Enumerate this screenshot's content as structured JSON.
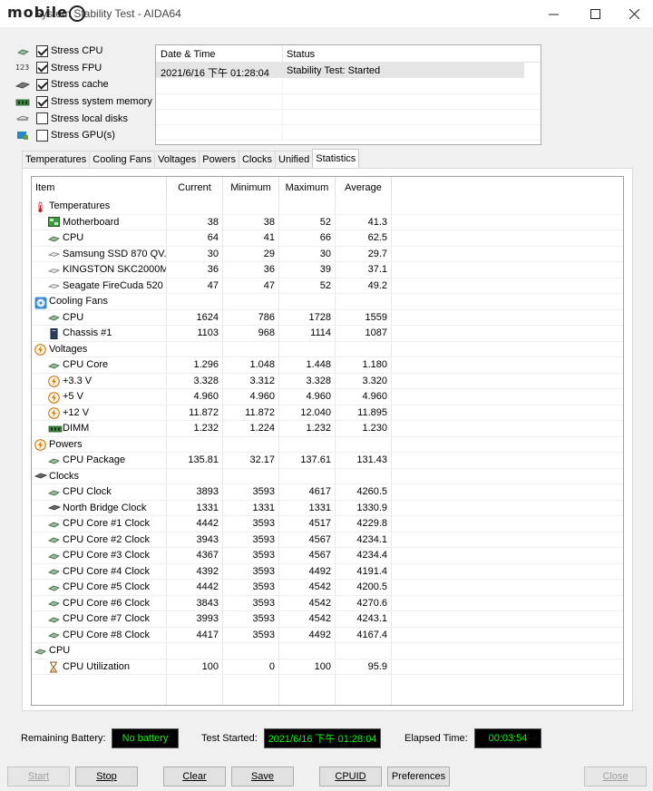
{
  "window": {
    "title": "System Stability Test - AIDA64",
    "watermark": "mobile01"
  },
  "stress_options": [
    {
      "label": "Stress CPU",
      "checked": true,
      "icon": "cpu-chip-icon"
    },
    {
      "label": "Stress FPU",
      "checked": true,
      "icon": "fpu-123-icon"
    },
    {
      "label": "Stress cache",
      "checked": true,
      "icon": "cache-chip-icon"
    },
    {
      "label": "Stress system memory",
      "checked": true,
      "icon": "memory-module-icon"
    },
    {
      "label": "Stress local disks",
      "checked": false,
      "icon": "disk-icon"
    },
    {
      "label": "Stress GPU(s)",
      "checked": false,
      "icon": "gpu-icon"
    }
  ],
  "log": {
    "headers": {
      "datetime": "Date & Time",
      "status": "Status"
    },
    "rows": [
      {
        "datetime": "2021/6/16 下午 01:28:04",
        "status": "Stability Test: Started"
      }
    ]
  },
  "tabs": [
    "Temperatures",
    "Cooling Fans",
    "Voltages",
    "Powers",
    "Clocks",
    "Unified",
    "Statistics"
  ],
  "active_tab": "Statistics",
  "stats": {
    "headers": {
      "item": "Item",
      "current": "Current",
      "minimum": "Minimum",
      "maximum": "Maximum",
      "average": "Average"
    },
    "rows": [
      {
        "type": "group",
        "icon": "thermometer-icon",
        "item": "Temperatures"
      },
      {
        "type": "item",
        "icon": "motherboard-icon",
        "item": "Motherboard",
        "current": "38",
        "minimum": "38",
        "maximum": "52",
        "average": "41.3"
      },
      {
        "type": "item",
        "icon": "cpu-chip-icon",
        "item": "CPU",
        "current": "64",
        "minimum": "41",
        "maximum": "66",
        "average": "62.5"
      },
      {
        "type": "item",
        "icon": "drive-icon",
        "item": "Samsung SSD 870 QV...",
        "current": "30",
        "minimum": "29",
        "maximum": "30",
        "average": "29.7"
      },
      {
        "type": "item",
        "icon": "drive-icon",
        "item": "KINGSTON SKC2000M...",
        "current": "36",
        "minimum": "36",
        "maximum": "39",
        "average": "37.1"
      },
      {
        "type": "item",
        "icon": "drive-icon",
        "item": "Seagate FireCuda 520 ...",
        "current": "47",
        "minimum": "47",
        "maximum": "52",
        "average": "49.2"
      },
      {
        "type": "group",
        "icon": "fan-icon",
        "item": "Cooling Fans"
      },
      {
        "type": "item",
        "icon": "cpu-chip-icon",
        "item": "CPU",
        "current": "1624",
        "minimum": "786",
        "maximum": "1728",
        "average": "1559"
      },
      {
        "type": "item",
        "icon": "chassis-icon",
        "item": "Chassis #1",
        "current": "1103",
        "minimum": "968",
        "maximum": "1114",
        "average": "1087"
      },
      {
        "type": "group",
        "icon": "lightning-icon",
        "item": "Voltages"
      },
      {
        "type": "item",
        "icon": "cpu-chip-icon",
        "item": "CPU Core",
        "current": "1.296",
        "minimum": "1.048",
        "maximum": "1.448",
        "average": "1.180"
      },
      {
        "type": "item",
        "icon": "lightning-icon",
        "item": "+3.3 V",
        "current": "3.328",
        "minimum": "3.312",
        "maximum": "3.328",
        "average": "3.320"
      },
      {
        "type": "item",
        "icon": "lightning-icon",
        "item": "+5 V",
        "current": "4.960",
        "minimum": "4.960",
        "maximum": "4.960",
        "average": "4.960"
      },
      {
        "type": "item",
        "icon": "lightning-icon",
        "item": "+12 V",
        "current": "11.872",
        "minimum": "11.872",
        "maximum": "12.040",
        "average": "11.895"
      },
      {
        "type": "item",
        "icon": "memory-module-icon",
        "item": "DIMM",
        "current": "1.232",
        "minimum": "1.224",
        "maximum": "1.232",
        "average": "1.230"
      },
      {
        "type": "group",
        "icon": "lightning-icon",
        "item": "Powers"
      },
      {
        "type": "item",
        "icon": "cpu-chip-icon",
        "item": "CPU Package",
        "current": "135.81",
        "minimum": "32.17",
        "maximum": "137.61",
        "average": "131.43"
      },
      {
        "type": "group",
        "icon": "chip-dark-icon",
        "item": "Clocks"
      },
      {
        "type": "item",
        "icon": "cpu-chip-icon",
        "item": "CPU Clock",
        "current": "3893",
        "minimum": "3593",
        "maximum": "4617",
        "average": "4260.5"
      },
      {
        "type": "item",
        "icon": "chip-dark-icon",
        "item": "North Bridge Clock",
        "current": "1331",
        "minimum": "1331",
        "maximum": "1331",
        "average": "1330.9"
      },
      {
        "type": "item",
        "icon": "cpu-chip-icon",
        "item": "CPU Core #1 Clock",
        "current": "4442",
        "minimum": "3593",
        "maximum": "4517",
        "average": "4229.8"
      },
      {
        "type": "item",
        "icon": "cpu-chip-icon",
        "item": "CPU Core #2 Clock",
        "current": "3943",
        "minimum": "3593",
        "maximum": "4567",
        "average": "4234.1"
      },
      {
        "type": "item",
        "icon": "cpu-chip-icon",
        "item": "CPU Core #3 Clock",
        "current": "4367",
        "minimum": "3593",
        "maximum": "4567",
        "average": "4234.4"
      },
      {
        "type": "item",
        "icon": "cpu-chip-icon",
        "item": "CPU Core #4 Clock",
        "current": "4392",
        "minimum": "3593",
        "maximum": "4492",
        "average": "4191.4"
      },
      {
        "type": "item",
        "icon": "cpu-chip-icon",
        "item": "CPU Core #5 Clock",
        "current": "4442",
        "minimum": "3593",
        "maximum": "4542",
        "average": "4200.5"
      },
      {
        "type": "item",
        "icon": "cpu-chip-icon",
        "item": "CPU Core #6 Clock",
        "current": "3843",
        "minimum": "3593",
        "maximum": "4542",
        "average": "4270.6"
      },
      {
        "type": "item",
        "icon": "cpu-chip-icon",
        "item": "CPU Core #7 Clock",
        "current": "3993",
        "minimum": "3593",
        "maximum": "4542",
        "average": "4243.1"
      },
      {
        "type": "item",
        "icon": "cpu-chip-icon",
        "item": "CPU Core #8 Clock",
        "current": "4417",
        "minimum": "3593",
        "maximum": "4492",
        "average": "4167.4"
      },
      {
        "type": "group",
        "icon": "cpu-chip-icon",
        "item": "CPU"
      },
      {
        "type": "item",
        "icon": "hourglass-icon",
        "item": "CPU Utilization",
        "current": "100",
        "minimum": "0",
        "maximum": "100",
        "average": "95.9"
      }
    ]
  },
  "status": {
    "battery_label": "Remaining Battery:",
    "battery_value": "No battery",
    "started_label": "Test Started:",
    "started_value": "2021/6/16 下午 01:28:04",
    "elapsed_label": "Elapsed Time:",
    "elapsed_value": "00:03:54",
    "value_color": "#00ff00"
  },
  "buttons": {
    "start": "Start",
    "stop": "Stop",
    "clear": "Clear",
    "save": "Save",
    "cpuid": "CPUID",
    "preferences": "Preferences",
    "close": "Close"
  }
}
